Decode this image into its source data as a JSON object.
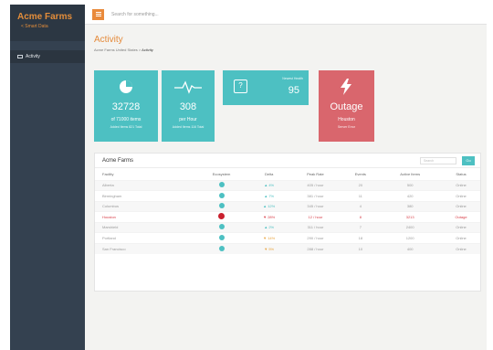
{
  "brand": {
    "title": "Acme Farms",
    "subtitle": "< Smart Data"
  },
  "sidebar": {
    "items": [
      {
        "label": "Activity"
      }
    ]
  },
  "topbar": {
    "search_placeholder": "Search for something..."
  },
  "page": {
    "title": "Activity",
    "breadcrumb": {
      "root": "Acme Farms United States",
      "current": "Activity"
    }
  },
  "tiles": [
    {
      "value": "32728",
      "label": "of 71000 items",
      "sub": "Added Items 821 Total"
    },
    {
      "value": "308",
      "label": "per Hour",
      "sub": "Added Items 116 Total"
    },
    {
      "label": "Newest Health",
      "value": "95"
    },
    {
      "value": "Outage",
      "label": "Houston",
      "sub": "Server Error"
    }
  ],
  "panel": {
    "title": "Acme Farms",
    "search_placeholder": "Search",
    "go_label": "Go",
    "columns": [
      "Facility",
      "Ecosystem",
      "Delta",
      "Peak Rate",
      "Events",
      "Active Items",
      "Status"
    ],
    "rows": [
      {
        "facility": "Alberta",
        "delta": "▲ 4%",
        "rate": "405 / hour",
        "events": "20",
        "items": "500",
        "status": "Online"
      },
      {
        "facility": "Birmingham",
        "delta": "▲ 7%",
        "rate": "381 / hour",
        "events": "11",
        "items": "420",
        "status": "Online"
      },
      {
        "facility": "Columbus",
        "delta": "▲ 12%",
        "rate": "345 / hour",
        "events": "4",
        "items": "380",
        "status": "Online"
      },
      {
        "facility": "Houston",
        "delta": "▼ 28%",
        "rate": "12 / hour",
        "events": "8",
        "items": "3213",
        "status": "Outage"
      },
      {
        "facility": "Marshield",
        "delta": "▲ 2%",
        "rate": "311 / hour",
        "events": "7",
        "items": "2400",
        "status": "Online"
      },
      {
        "facility": "Portland",
        "delta": "▼ 14%",
        "rate": "290 / hour",
        "events": "18",
        "items": "1200",
        "status": "Online"
      },
      {
        "facility": "San Francisco",
        "delta": "▼ 5%",
        "rate": "288 / hour",
        "events": "10",
        "items": "400",
        "status": "Online"
      }
    ]
  },
  "colors": {
    "teal": "#4dc0c2",
    "red": "#d9666d",
    "orange": "#e58a3a",
    "sidebar": "#344150"
  }
}
